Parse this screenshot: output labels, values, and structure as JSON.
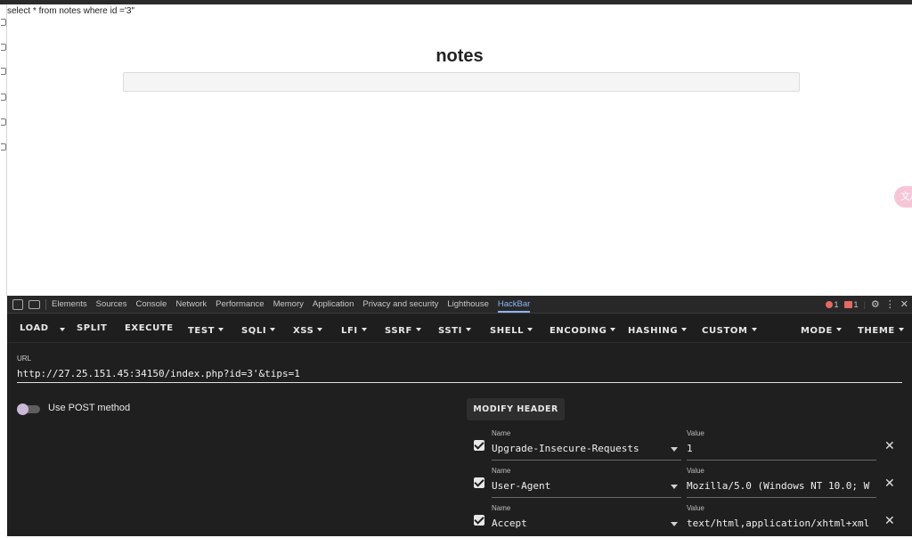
{
  "page": {
    "sql_text": "select * from notes where id ='3\"",
    "title": "notes"
  },
  "devtools": {
    "tabs": [
      "Elements",
      "Sources",
      "Console",
      "Network",
      "Performance",
      "Memory",
      "Application",
      "Privacy and security",
      "Lighthouse",
      "HackBar"
    ],
    "active_tab": "HackBar",
    "error_count": "1",
    "warning_count": "1"
  },
  "hackbar": {
    "toolbar": [
      {
        "label": "LOAD",
        "dropdown": false
      },
      {
        "label": "SPLIT",
        "dropdown": false
      },
      {
        "label": "EXECUTE",
        "dropdown": false
      },
      {
        "label": "TEST",
        "dropdown": true
      },
      {
        "label": "SQLI",
        "dropdown": true
      },
      {
        "label": "XSS",
        "dropdown": true
      },
      {
        "label": "LFI",
        "dropdown": true
      },
      {
        "label": "SSRF",
        "dropdown": true
      },
      {
        "label": "SSTI",
        "dropdown": true
      },
      {
        "label": "SHELL",
        "dropdown": true
      },
      {
        "label": "ENCODING",
        "dropdown": true
      },
      {
        "label": "HASHING",
        "dropdown": true
      },
      {
        "label": "CUSTOM",
        "dropdown": true
      }
    ],
    "mode_label": "MODE",
    "theme_label": "THEME",
    "url_label": "URL",
    "url_value": "http://27.25.151.45:34150/index.php?id=3'&tips=1",
    "post_label": "Use POST method",
    "post_enabled": false,
    "modify_header_label": "MODIFY HEADER",
    "name_label": "Name",
    "value_label": "Value",
    "headers": [
      {
        "name": "Upgrade-Insecure-Requests",
        "value": "1",
        "checked": true
      },
      {
        "name": "User-Agent",
        "value": "Mozilla/5.0 (Windows NT 10.0; W",
        "checked": true
      },
      {
        "name": "Accept",
        "value": "text/html,application/xhtml+xml",
        "checked": true
      }
    ]
  },
  "colors": {
    "devtools_bg": "#1f1f1f",
    "active_tab": "#8ab4f8",
    "error": "#e46962",
    "float_button": "#f7c6d6"
  }
}
